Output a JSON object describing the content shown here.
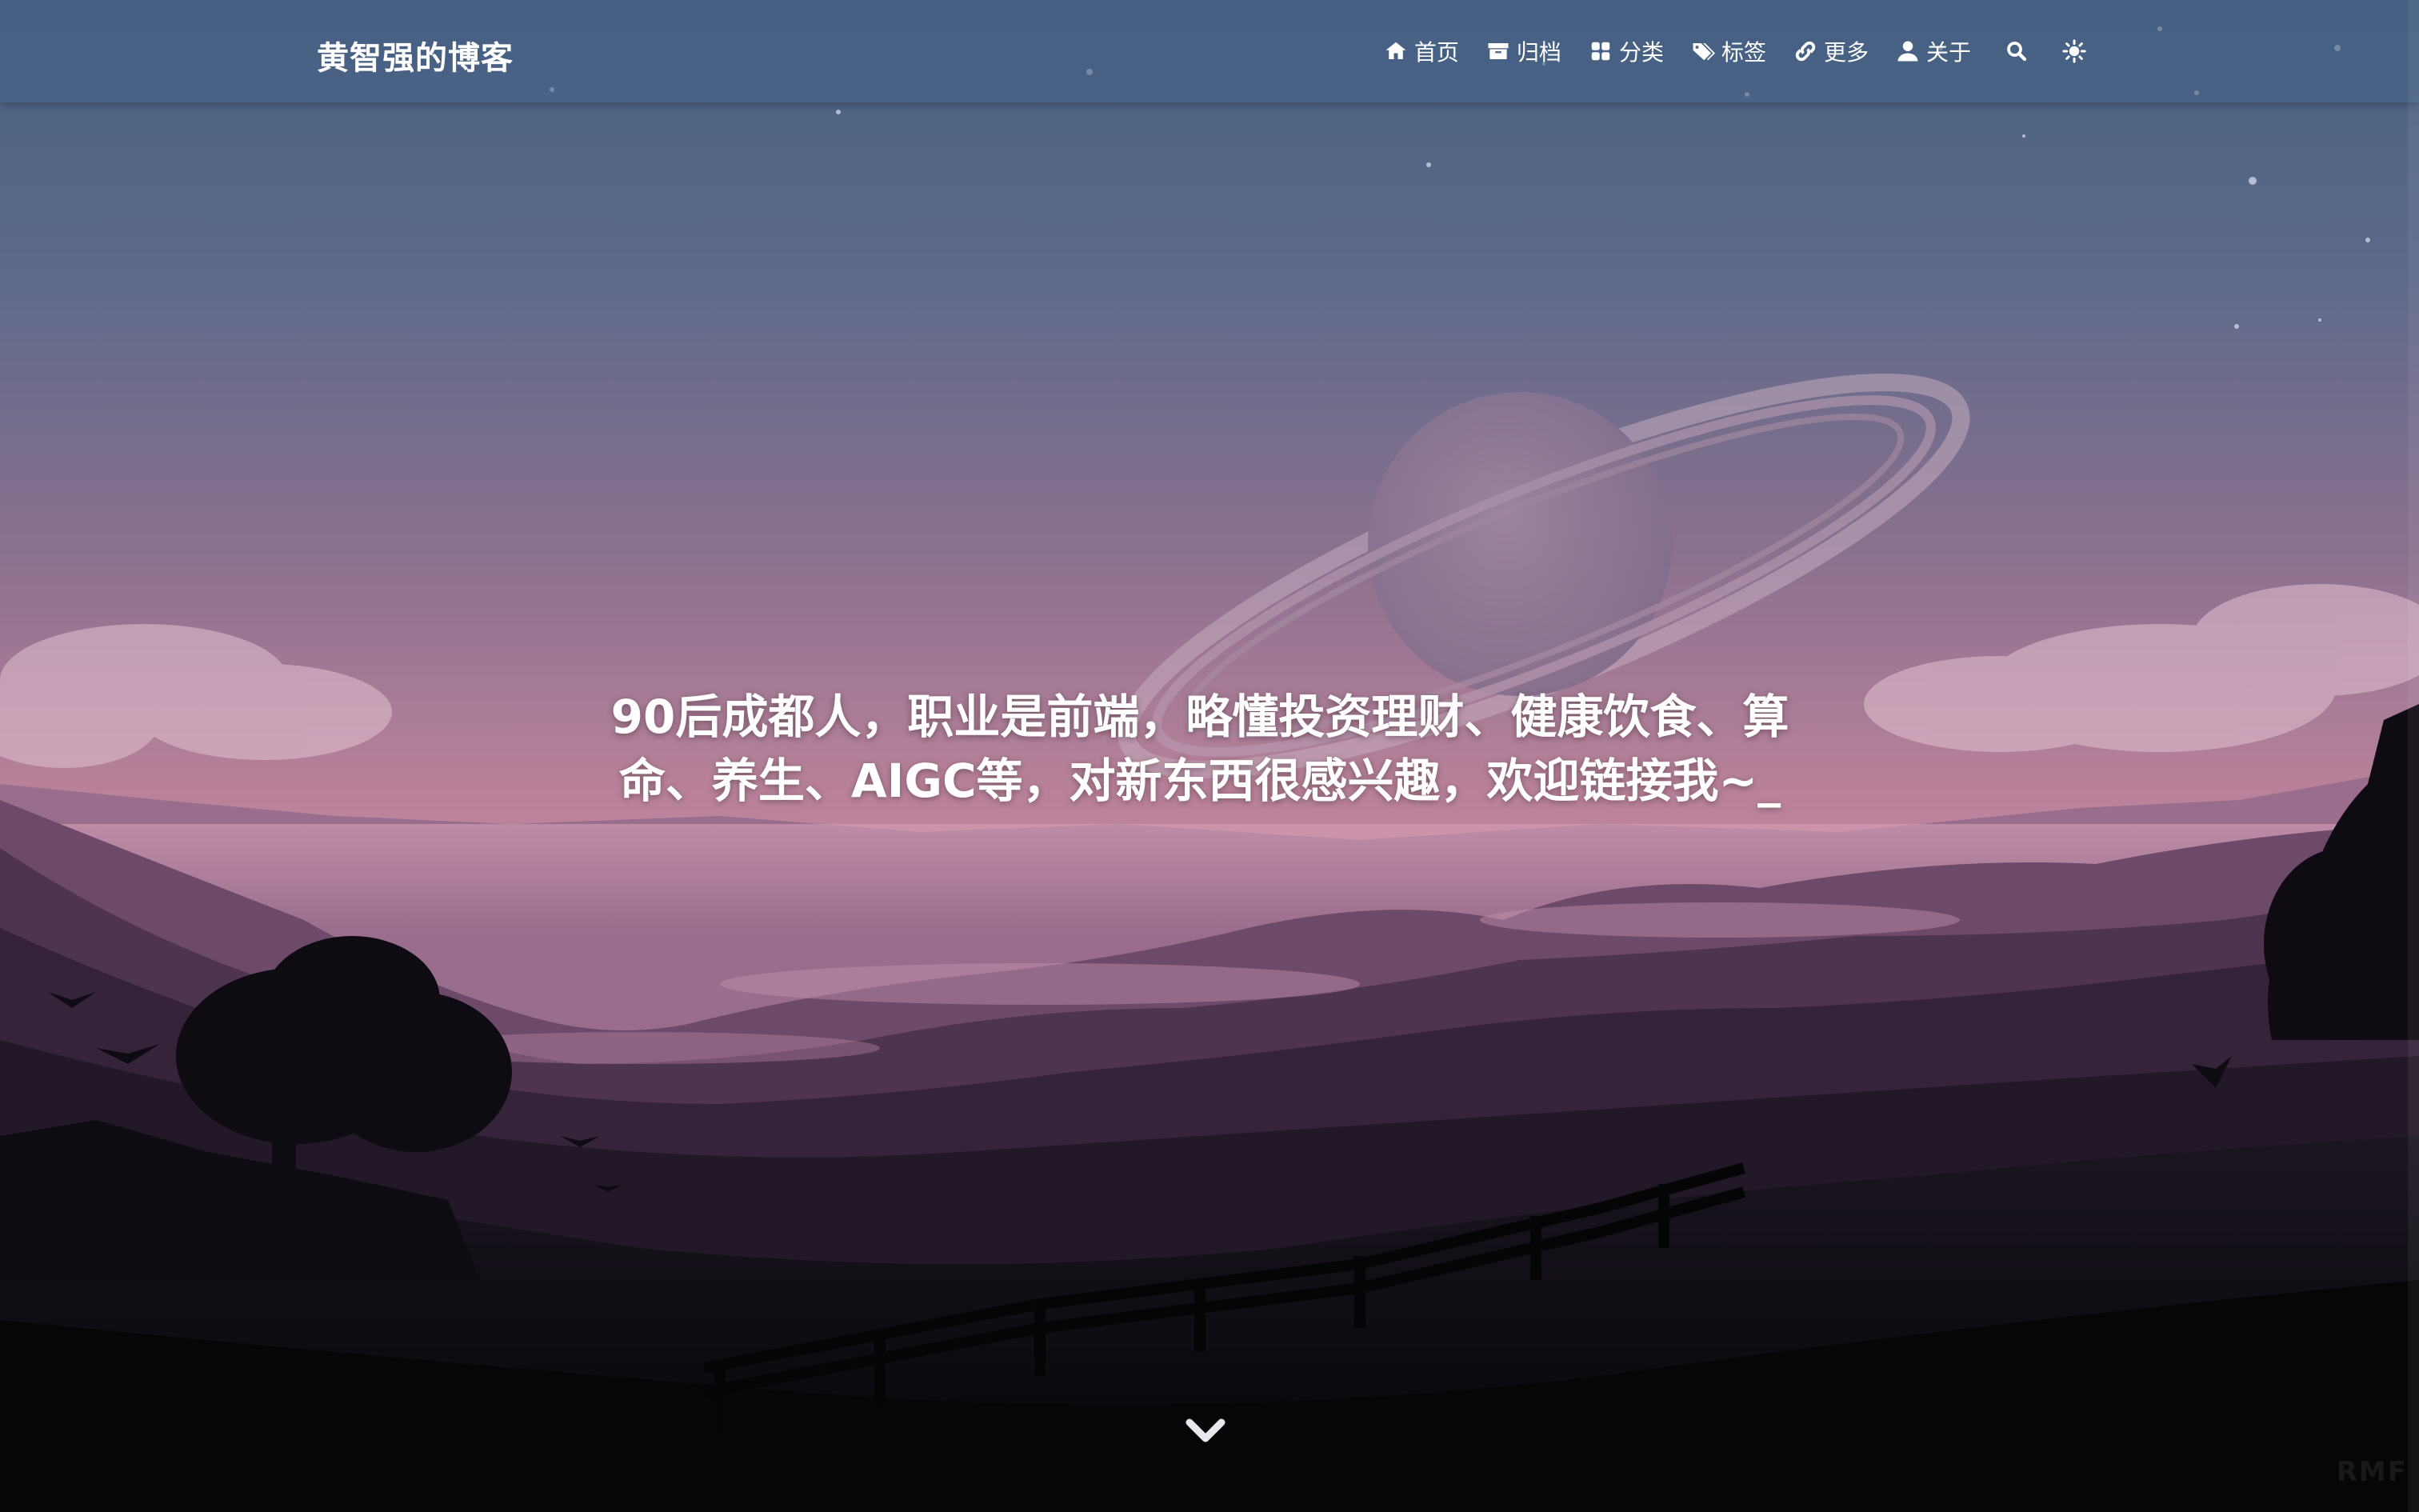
{
  "site": {
    "title": "黄智强的博客"
  },
  "nav": {
    "items": [
      {
        "icon": "home-icon",
        "label": "首页"
      },
      {
        "icon": "archive-icon",
        "label": "归档"
      },
      {
        "icon": "category-icon",
        "label": "分类"
      },
      {
        "icon": "tags-icon",
        "label": "标签"
      },
      {
        "icon": "link-icon",
        "label": "更多"
      },
      {
        "icon": "user-icon",
        "label": "关于"
      }
    ],
    "search_icon": "search-icon",
    "theme_icon": "sun-icon"
  },
  "hero": {
    "line1": "90后成都人，职业是前端，略懂投资理财、健康饮食、算",
    "line2": "命、养生、AIGC等，对新东西很感兴趣，欢迎链接我~",
    "cursor": "_"
  },
  "scroll_icon": "chevron-down-icon",
  "watermark": "RMF",
  "colors": {
    "sky_top": "#4b6388",
    "sky_mid": "#8b7394",
    "horizon": "#c58aa6",
    "foreground": "#0c0a10"
  }
}
